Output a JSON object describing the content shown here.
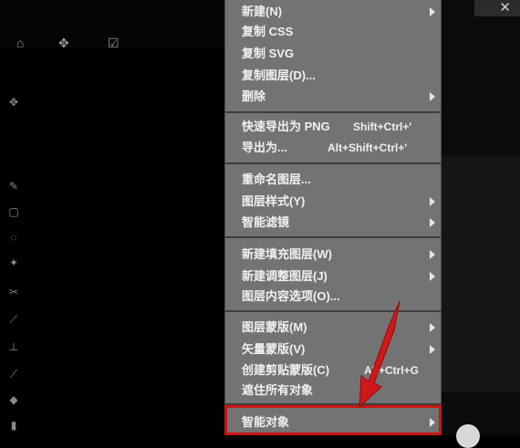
{
  "menu": {
    "items": [
      {
        "label": "新建(N)",
        "shortcut": "",
        "submenu": true
      },
      {
        "label": "复制 CSS",
        "shortcut": "",
        "submenu": false
      },
      {
        "label": "复制 SVG",
        "shortcut": "",
        "submenu": false
      },
      {
        "label": "复制图层(D)...",
        "shortcut": "",
        "submenu": false
      },
      {
        "label": "删除",
        "shortcut": "",
        "submenu": true
      },
      {
        "label": "快速导出为 PNG",
        "shortcut": "Shift+Ctrl+'",
        "submenu": false
      },
      {
        "label": "导出为...",
        "shortcut": "Alt+Shift+Ctrl+'",
        "submenu": false
      },
      {
        "label": "重命名图层...",
        "shortcut": "",
        "submenu": false
      },
      {
        "label": "图层样式(Y)",
        "shortcut": "",
        "submenu": true
      },
      {
        "label": "智能滤镜",
        "shortcut": "",
        "submenu": true
      },
      {
        "label": "新建填充图层(W)",
        "shortcut": "",
        "submenu": true
      },
      {
        "label": "新建调整图层(J)",
        "shortcut": "",
        "submenu": true
      },
      {
        "label": "图层内容选项(O)...",
        "shortcut": "",
        "submenu": false
      },
      {
        "label": "图层蒙版(M)",
        "shortcut": "",
        "submenu": true
      },
      {
        "label": "矢量蒙版(V)",
        "shortcut": "",
        "submenu": true
      },
      {
        "label": "创建剪贴蒙版(C)",
        "shortcut": "Alt+Ctrl+G",
        "submenu": false
      },
      {
        "label": "遮住所有对象",
        "shortcut": "",
        "submenu": false
      },
      {
        "label": "智能对象",
        "shortcut": "",
        "submenu": true
      }
    ]
  },
  "colors": {
    "menu_bg": "#737373",
    "highlight": "#c81414",
    "text": "#f0f0f0"
  },
  "icons": [
    "home-icon",
    "move-icon",
    "checkbox-icon",
    "close-icon"
  ]
}
